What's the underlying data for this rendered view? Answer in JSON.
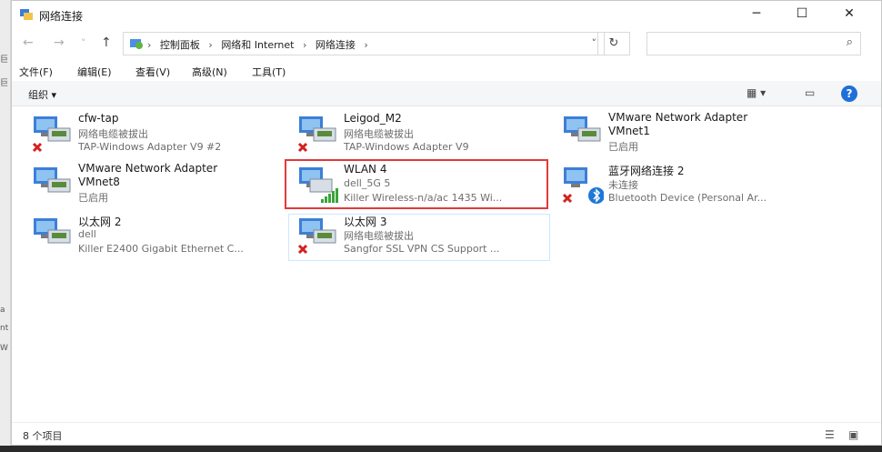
{
  "window": {
    "title": "网络连接"
  },
  "nav": {
    "back": "←",
    "forward": "→",
    "recent": "˅",
    "up": "↑"
  },
  "address": {
    "crumbs": [
      "控制面板",
      "网络和 Internet",
      "网络连接"
    ],
    "sep": "›"
  },
  "search": {
    "placeholder": ""
  },
  "menu": [
    "文件(F)",
    "编辑(E)",
    "查看(V)",
    "高级(N)",
    "工具(T)"
  ],
  "toolbar": {
    "organize": "组织 ▾"
  },
  "connections": [
    {
      "name": "cfw-tap",
      "status": "网络电缆被拔出",
      "device": "TAP-Windows Adapter V9 #2",
      "icon": "network-adapter-icon",
      "badge": "red-x"
    },
    {
      "name": "Leigod_M2",
      "status": "网络电缆被拔出",
      "device": "TAP-Windows Adapter V9",
      "icon": "network-adapter-icon",
      "badge": "red-x"
    },
    {
      "name": "VMware Network Adapter",
      "name2": "VMnet1",
      "status": "已启用",
      "icon": "network-adapter-icon",
      "badge": "none"
    },
    {
      "name": "VMware Network Adapter",
      "name2": "VMnet8",
      "status": "已启用",
      "icon": "network-adapter-icon",
      "badge": "none"
    },
    {
      "name": "WLAN 4",
      "status": "dell_5G 5",
      "device": "Killer Wireless-n/a/ac 1435 Wi...",
      "icon": "wifi-adapter-icon",
      "badge": "signal"
    },
    {
      "name": "蓝牙网络连接 2",
      "status": "未连接",
      "device": "Bluetooth Device (Personal Ar...",
      "icon": "bluetooth-adapter-icon",
      "badge": "red-x"
    },
    {
      "name": "以太网 2",
      "status": "dell",
      "device": "Killer E2400 Gigabit Ethernet C...",
      "icon": "network-adapter-icon",
      "badge": "none"
    },
    {
      "name": "以太网 3",
      "status": "网络电缆被拔出",
      "device": "Sangfor SSL VPN CS Support ...",
      "icon": "network-adapter-icon",
      "badge": "red-x"
    }
  ],
  "status": {
    "count": "8 个项目"
  },
  "colors": {
    "highlight": "#e03a3a",
    "selection": "#cce8ff",
    "accent": "#1e6fd9"
  }
}
